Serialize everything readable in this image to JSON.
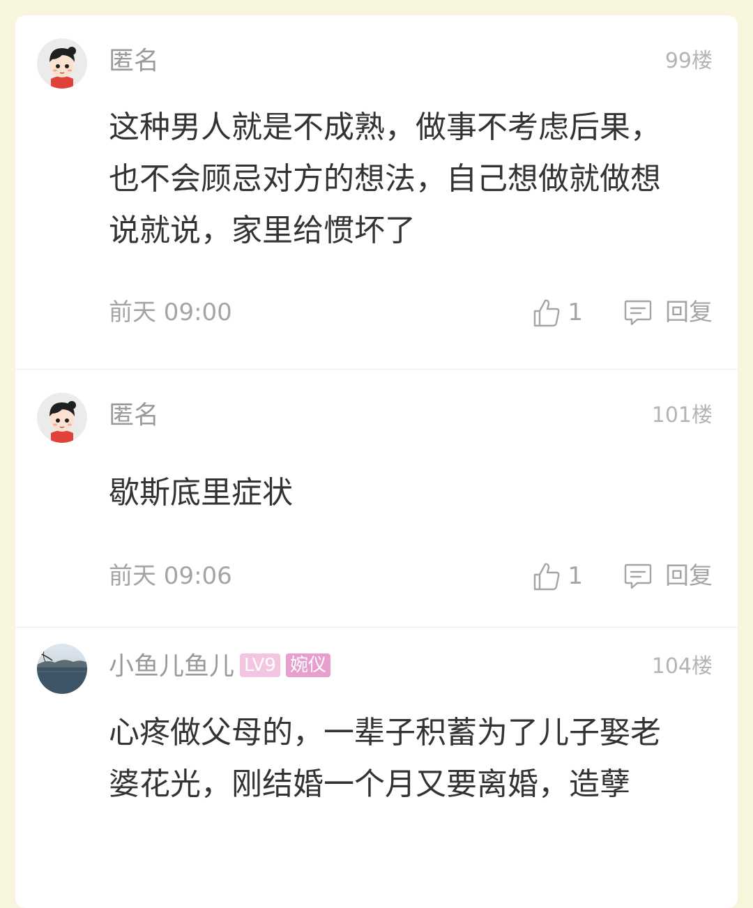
{
  "comments": [
    {
      "username": "匿名",
      "floor": "99楼",
      "text": "这种男人就是不成熟，做事不考虑后果，也不会顾忌对方的想法，自己想做就做想说就说，家里给惯坏了",
      "time": "前天 09:00",
      "likes": "1",
      "reply_label": "回复",
      "avatar_icon": "cartoon-girl-avatar"
    },
    {
      "username": "匿名",
      "floor": "101楼",
      "text": "歇斯底里症状",
      "time": "前天 09:06",
      "likes": "1",
      "reply_label": "回复",
      "avatar_icon": "cartoon-girl-avatar"
    },
    {
      "username": "小鱼儿鱼儿",
      "level": "LV9",
      "title_badge": "婉仪",
      "floor": "104楼",
      "text": "心疼做父母的，一辈子积蓄为了儿子娶老婆花光，刚结婚一个月又要离婚，造孽",
      "avatar_icon": "lake-landscape-avatar"
    }
  ],
  "colors": {
    "page_background": "#f7f6dc",
    "card_background": "#ffffff",
    "level_badge": "#f2c6e0",
    "title_badge": "#e69fce"
  }
}
